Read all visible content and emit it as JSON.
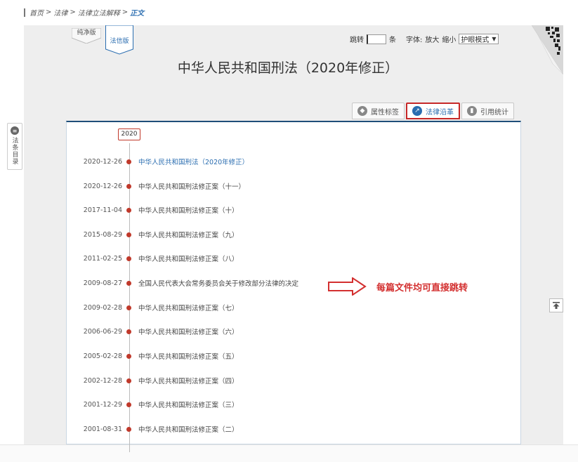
{
  "breadcrumb": {
    "items": [
      "首页",
      "法律",
      "法律立法解释"
    ],
    "separator": ">",
    "current": "正文"
  },
  "version_tabs": {
    "plain": "纯净版",
    "legal": "法信版"
  },
  "controls": {
    "jump_label": "跳转",
    "jump_value": "",
    "unit": "条",
    "font_label": "字体:",
    "enlarge": "放大",
    "shrink": "缩小",
    "mode_selected": "护眼模式"
  },
  "document": {
    "title": "中华人民共和国刑法（2020年修正）"
  },
  "panel_tabs": {
    "attributes": "属性标签",
    "history": "法律沿革",
    "citation": "引用统计"
  },
  "timeline": {
    "year": "2020",
    "entries": [
      {
        "date": "2020-12-26",
        "title": "中华人民共和国刑法（2020年修正）"
      },
      {
        "date": "2020-12-26",
        "title": "中华人民共和国刑法修正案（十一）"
      },
      {
        "date": "2017-11-04",
        "title": "中华人民共和国刑法修正案（十）"
      },
      {
        "date": "2015-08-29",
        "title": "中华人民共和国刑法修正案（九）"
      },
      {
        "date": "2011-02-25",
        "title": "中华人民共和国刑法修正案（八）"
      },
      {
        "date": "2009-08-27",
        "title": "全国人民代表大会常务委员会关于修改部分法律的决定"
      },
      {
        "date": "2009-02-28",
        "title": "中华人民共和国刑法修正案（七）"
      },
      {
        "date": "2006-06-29",
        "title": "中华人民共和国刑法修正案（六）"
      },
      {
        "date": "2005-02-28",
        "title": "中华人民共和国刑法修正案（五）"
      },
      {
        "date": "2002-12-28",
        "title": "中华人民共和国刑法修正案（四）"
      },
      {
        "date": "2001-12-29",
        "title": "中华人民共和国刑法修正案（三）"
      },
      {
        "date": "2001-08-31",
        "title": "中华人民共和国刑法修正案（二）"
      }
    ]
  },
  "annotation": {
    "text": "每篇文件均可直接跳转"
  },
  "side_toc": {
    "label": "法条目录"
  },
  "colors": {
    "accent_blue": "#2a6db0",
    "highlight_red": "#c62828",
    "dot_red": "#c0392b",
    "panel_border": "#1f4e79"
  }
}
